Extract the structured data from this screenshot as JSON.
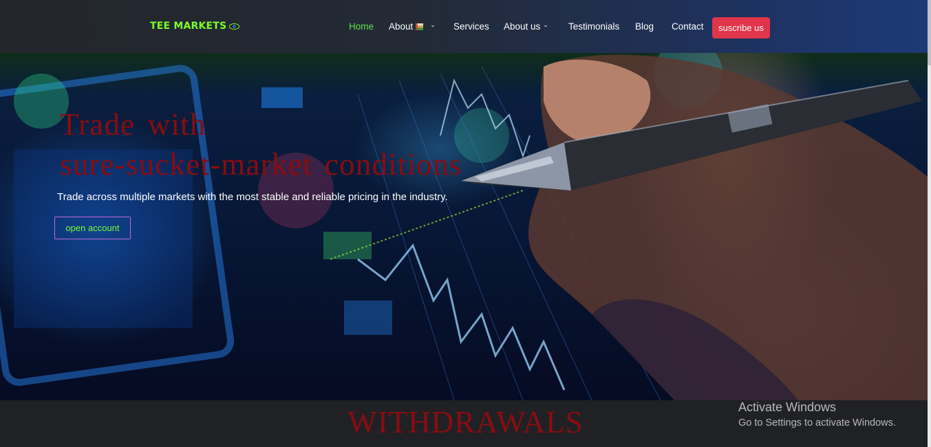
{
  "brand": {
    "name": "TEE MARKETS",
    "icon": "eye-logo-icon"
  },
  "nav": {
    "items": [
      {
        "label": "Home",
        "active": true
      },
      {
        "label": "About",
        "has_flag": true,
        "dropdown": true
      },
      {
        "label": "Services"
      },
      {
        "label": "About us",
        "dropdown": true
      },
      {
        "label": "Testimonials"
      },
      {
        "label": "Blog"
      },
      {
        "label": "Contact"
      }
    ],
    "cta_label": "suscribe us"
  },
  "hero": {
    "title_line1": "Trade  with",
    "title_line2": "sure-sucket-market  conditions",
    "subtitle": "Trade across multiple markets with the most stable and reliable pricing in the industry.",
    "button_label": "open account"
  },
  "section": {
    "heading": "WITHDRAWALS"
  },
  "os_watermark": {
    "title": "Activate Windows",
    "subtitle": "Go to Settings to activate Windows."
  },
  "colors": {
    "brand_green": "#7cff2a",
    "nav_active": "#5de04a",
    "cta_red": "#e0354a",
    "heading_red": "#8a0c10",
    "button_border": "#c26ad8"
  }
}
